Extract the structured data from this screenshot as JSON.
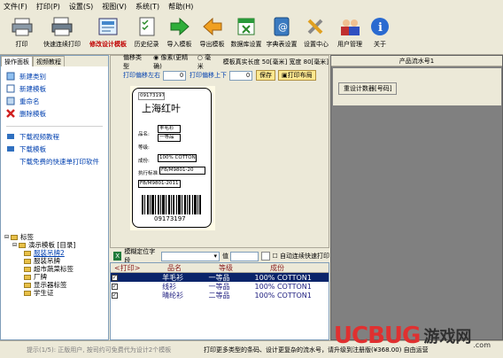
{
  "menu": [
    "文件(F)",
    "打印(P)",
    "设置(S)",
    "视图(V)",
    "系统(T)",
    "帮助(H)"
  ],
  "toolbar": [
    {
      "label": "打印",
      "icon": "printer-icon"
    },
    {
      "label": "快速连续打印",
      "icon": "fast-print-icon"
    },
    {
      "label": "修改设计模板",
      "icon": "edit-template-icon",
      "active": true
    },
    {
      "label": "历史纪录",
      "icon": "history-icon"
    },
    {
      "label": "导入模板",
      "icon": "import-icon"
    },
    {
      "label": "导出模板",
      "icon": "export-icon"
    },
    {
      "label": "数据库设置",
      "icon": "database-icon"
    },
    {
      "label": "字典表设置",
      "icon": "dictionary-icon"
    },
    {
      "label": "设置中心",
      "icon": "settings-icon"
    },
    {
      "label": "用户管理",
      "icon": "users-icon"
    },
    {
      "label": "关于",
      "icon": "info-icon"
    }
  ],
  "left": {
    "tabs": [
      "操作面板",
      "视频教程"
    ],
    "actions": [
      {
        "label": "新建类别",
        "icon": "new-category-icon"
      },
      {
        "label": "新建模板",
        "icon": "new-template-icon"
      },
      {
        "label": "重命名",
        "icon": "rename-icon"
      },
      {
        "label": "删除模板",
        "icon": "delete-icon"
      }
    ],
    "links": [
      {
        "label": "下载视频教程",
        "icon": "video-icon"
      },
      {
        "label": "下载模板",
        "icon": "download-icon"
      },
      {
        "label": "下载免费的快速单打印软件",
        "icon": ""
      }
    ],
    "tree": [
      {
        "label": "标签",
        "level": 0
      },
      {
        "label": "演示模板 [目录]",
        "level": 1
      },
      {
        "label": "服装吊牌2",
        "level": 2,
        "selected": true
      },
      {
        "label": "服装吊牌",
        "level": 2
      },
      {
        "label": "超市蔬菜标签",
        "level": 2
      },
      {
        "label": "厂牌",
        "level": 2
      },
      {
        "label": "显示器标签",
        "level": 2
      },
      {
        "label": "学生证",
        "level": 2
      }
    ]
  },
  "center": {
    "offset_label": "偏移类型",
    "unit_pixel": "像素(更精确)",
    "unit_mm": "毫米",
    "template_size": "模板真实长度 50[毫米] 宽度 80[毫米]",
    "offset_lr_label": "打印偏移左右",
    "offset_lr": "0",
    "offset_ud_label": "打印偏移上下",
    "offset_ud": "0",
    "save": "保存",
    "print_layout": "打印布局"
  },
  "label": {
    "code_top": "09173197",
    "title": "上海红叶",
    "fields": [
      {
        "name": "品名:",
        "value": "羊毛衫"
      },
      {
        "name": "等级:",
        "value": "一等品"
      },
      {
        "name": "成份:",
        "value": "100% COTTON"
      },
      {
        "name": "执行标准:",
        "value": "FB/M9801-20"
      }
    ],
    "standard_box": "FB/M9801-2011",
    "barcode_text": "09173197"
  },
  "filterbar": {
    "label": "模糊定位字段",
    "value_label": "值",
    "auto_continue": "自动连续快速打印"
  },
  "grid": {
    "headers": [
      "<打印>",
      "品名",
      "等级",
      "成份"
    ],
    "rows": [
      {
        "checked": true,
        "name": "羊毛衫",
        "grade": "一等品",
        "comp": "100% COTTON1"
      },
      {
        "checked": true,
        "name": "线衫",
        "grade": "一等品",
        "comp": "100% COTTON1"
      },
      {
        "checked": true,
        "name": "晴纶衫",
        "grade": "二等品",
        "comp": "100% COTTON1"
      }
    ]
  },
  "right": {
    "title": "产品流水号1",
    "reset_button": "重设计数器[号码]"
  },
  "status": {
    "left": "提示(1/5): 正版用户, 按司约可免费代为设计2个模板",
    "right": "打印更多类型的条码、设计更复杂的流水号，请升级到注册版(¥368.00) 自由运营"
  },
  "watermark": {
    "brand": "UCBUG",
    "text": "游戏网",
    "domain": ".com"
  }
}
